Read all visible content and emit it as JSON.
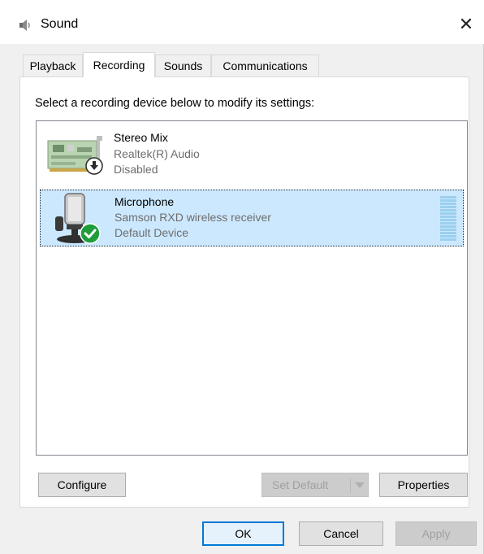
{
  "window": {
    "title": "Sound",
    "icon": "speaker-icon",
    "close_glyph": "✕"
  },
  "tabs": [
    {
      "label": "Playback",
      "active": false
    },
    {
      "label": "Recording",
      "active": true
    },
    {
      "label": "Sounds",
      "active": false
    },
    {
      "label": "Communications",
      "active": false
    }
  ],
  "recording": {
    "instruction": "Select a recording device below to modify its settings:",
    "devices": [
      {
        "name": "Stereo Mix",
        "driver": "Realtek(R) Audio",
        "status": "Disabled",
        "icon": "sound-card-icon",
        "badge": "disabled-arrow-icon",
        "selected": false
      },
      {
        "name": "Microphone",
        "driver": "Samson RXD wireless receiver",
        "status": "Default Device",
        "icon": "microphone-icon",
        "badge": "default-check-icon",
        "selected": true,
        "level_fraction": 0
      }
    ]
  },
  "buttons": {
    "configure": "Configure",
    "set_default": "Set Default",
    "properties": "Properties",
    "ok": "OK",
    "cancel": "Cancel",
    "apply": "Apply"
  },
  "colors": {
    "selection": "#cce8ff",
    "focus_border": "#0078d7",
    "check_badge": "#1f9d3a",
    "disabled_text": "#a0a0a0"
  }
}
